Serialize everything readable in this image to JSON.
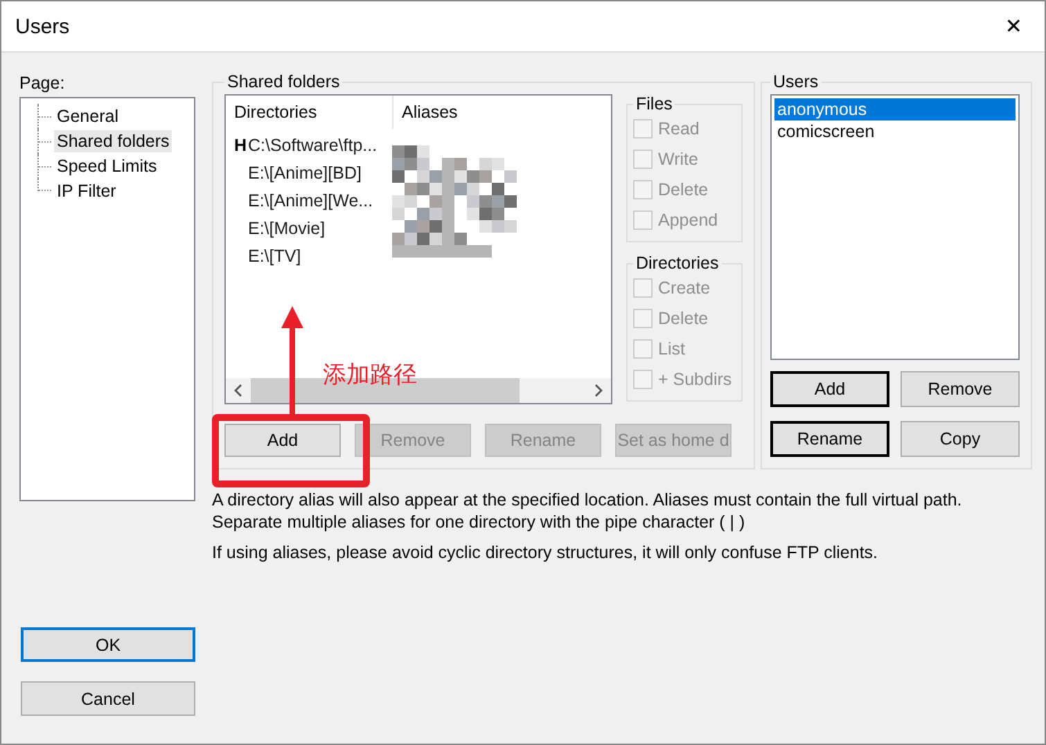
{
  "window": {
    "title": "Users",
    "close": "✕"
  },
  "page_label": "Page:",
  "pages": [
    {
      "label": "General",
      "selected": false
    },
    {
      "label": "Shared folders",
      "selected": true
    },
    {
      "label": "Speed Limits",
      "selected": false
    },
    {
      "label": "IP Filter",
      "selected": false
    }
  ],
  "shared_folders": {
    "title": "Shared folders",
    "columns": [
      "Directories",
      "Aliases"
    ],
    "rows": [
      {
        "marker": "H",
        "path": "C:\\Software\\ftp..."
      },
      {
        "path": "E:\\[Anime][BD]"
      },
      {
        "path": "E:\\[Anime][We..."
      },
      {
        "path": "E:\\[Movie]"
      },
      {
        "path": "E:\\[TV]"
      }
    ],
    "buttons": [
      {
        "label": "Add",
        "disabled": false
      },
      {
        "label": "Remove",
        "disabled": true
      },
      {
        "label": "Rename",
        "disabled": true
      },
      {
        "label": "Set as home d",
        "disabled": true
      }
    ]
  },
  "files": {
    "title": "Files",
    "options": [
      {
        "label": "Read",
        "checked": false,
        "disabled": true
      },
      {
        "label": "Write",
        "checked": false,
        "disabled": true
      },
      {
        "label": "Delete",
        "checked": false,
        "disabled": true
      },
      {
        "label": "Append",
        "checked": false,
        "disabled": true
      }
    ]
  },
  "directories": {
    "title": "Directories",
    "options": [
      {
        "label": "Create",
        "checked": false,
        "disabled": true
      },
      {
        "label": "Delete",
        "checked": false,
        "disabled": true
      },
      {
        "label": "List",
        "checked": false,
        "disabled": true
      },
      {
        "label": "+ Subdirs",
        "checked": false,
        "disabled": true
      }
    ]
  },
  "users": {
    "title": "Users",
    "items": [
      {
        "label": "anonymous",
        "selected": true
      },
      {
        "label": "comicscreen",
        "selected": false
      }
    ],
    "buttons": [
      {
        "label": "Add",
        "outlined": true
      },
      {
        "label": "Remove",
        "outlined": false
      },
      {
        "label": "Rename",
        "outlined": true
      },
      {
        "label": "Copy",
        "outlined": false
      }
    ]
  },
  "notes": [
    "A directory alias will also appear at the specified location. Aliases must contain the full virtual path. Separate multiple aliases for one directory with the pipe character ( | )",
    "If using aliases, please avoid cyclic directory structures, it will only confuse FTP clients."
  ],
  "dialog_buttons": [
    "OK",
    "Cancel"
  ],
  "annotation": {
    "label": "添加路径"
  }
}
